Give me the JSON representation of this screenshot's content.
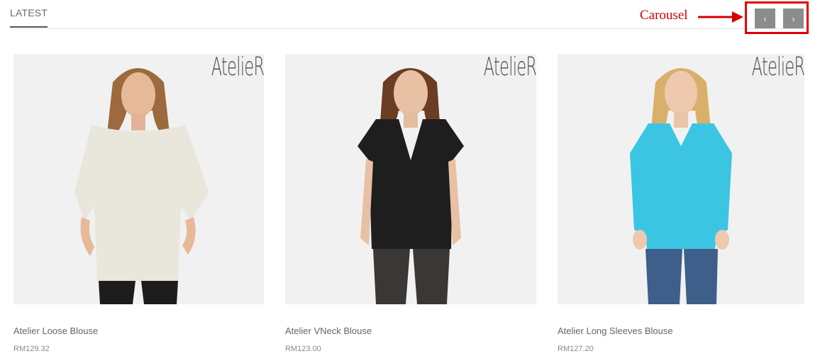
{
  "section": {
    "tab_label": "LATEST"
  },
  "annotation": {
    "label": "Carousel",
    "color": "#d40000"
  },
  "carousel": {
    "prev_icon": "chevron-left-icon",
    "next_icon": "chevron-right-icon",
    "prev_glyph": "‹",
    "next_glyph": "›"
  },
  "products": [
    {
      "name": "Atelier Loose Blouse",
      "price": "RM129.32",
      "brand": "AtelieR",
      "top_color": "#e9e7dc"
    },
    {
      "name": "Atelier VNeck Blouse",
      "price": "RM123.00",
      "brand": "AtelieR",
      "top_color": "#1e1e1e"
    },
    {
      "name": "Atelier Long Sleeves Blouse",
      "price": "RM127.20",
      "brand": "AtelieR",
      "top_color": "#3cc5e3"
    }
  ]
}
